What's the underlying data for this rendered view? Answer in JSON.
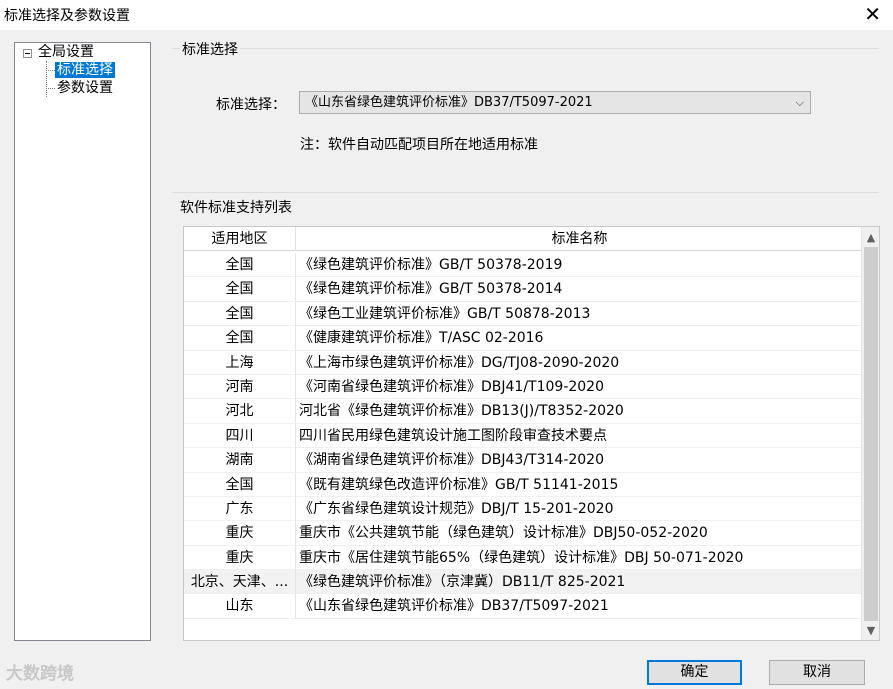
{
  "window": {
    "title": "标准选择及参数设置",
    "close_glyph": "✕"
  },
  "tree": {
    "root": "全局设置",
    "children": [
      "标准选择",
      "参数设置"
    ],
    "selected_index": 0
  },
  "section1": {
    "label": "标准选择",
    "field_label": "标准选择：",
    "select_value": "《山东省绿色建筑评价标准》DB37/T5097-2021",
    "note": "注：软件自动匹配项目所在地适用标准"
  },
  "section2": {
    "label": "软件标准支持列表",
    "columns": [
      "适用地区",
      "标准名称"
    ],
    "rows": [
      {
        "region": "全国",
        "name": "《绿色建筑评价标准》GB/T 50378-2019"
      },
      {
        "region": "全国",
        "name": "《绿色建筑评价标准》GB/T 50378-2014"
      },
      {
        "region": "全国",
        "name": "《绿色工业建筑评价标准》GB/T 50878-2013"
      },
      {
        "region": "全国",
        "name": "《健康建筑评价标准》T/ASC 02-2016"
      },
      {
        "region": "上海",
        "name": "《上海市绿色建筑评价标准》DG/TJ08-2090-2020"
      },
      {
        "region": "河南",
        "name": "《河南省绿色建筑评价标准》DBJ41/T109-2020"
      },
      {
        "region": "河北",
        "name": "河北省《绿色建筑评价标准》DB13(J)/T8352-2020"
      },
      {
        "region": "四川",
        "name": "四川省民用绿色建筑设计施工图阶段审查技术要点"
      },
      {
        "region": "湖南",
        "name": "《湖南省绿色建筑评价标准》DBJ43/T314-2020"
      },
      {
        "region": "全国",
        "name": "《既有建筑绿色改造评价标准》GB/T 51141-2015"
      },
      {
        "region": "广东",
        "name": "《广东省绿色建筑设计规范》DBJ/T 15-201-2020"
      },
      {
        "region": "重庆",
        "name": "重庆市《公共建筑节能（绿色建筑）设计标准》DBJ50-052-2020"
      },
      {
        "region": "重庆",
        "name": "重庆市《居住建筑节能65%（绿色建筑）设计标准》DBJ 50-071-2020"
      },
      {
        "region": "北京、天津、...",
        "name": "《绿色建筑评价标准》（京津冀）DB11/T 825-2021"
      },
      {
        "region": "山东",
        "name": "《山东省绿色建筑评价标准》DB37/T5097-2021"
      }
    ]
  },
  "buttons": {
    "ok": "确定",
    "cancel": "取消"
  },
  "watermark": "大数跨境",
  "colors": {
    "selection": "#0078d7",
    "background": "#f0f0f0"
  }
}
